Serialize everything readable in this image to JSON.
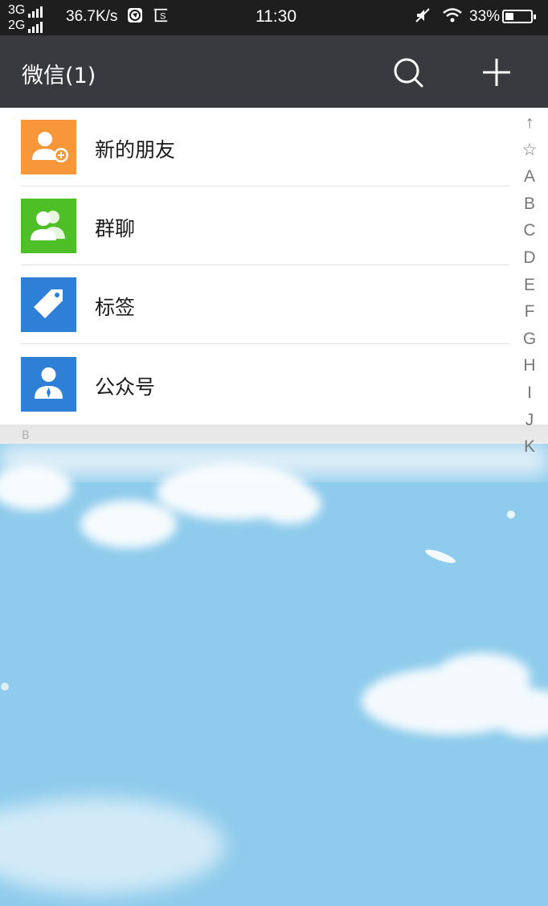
{
  "status_bar": {
    "net_type_1": "3G",
    "net_type_2": "2G",
    "speed": "36.7K/s",
    "time": "11:30",
    "battery_percent": "33%",
    "battery_level": 0.33
  },
  "header": {
    "title": "微信(1)",
    "icons": [
      "search-icon",
      "add-icon"
    ]
  },
  "contacts_menu": [
    {
      "label": "新的朋友",
      "icon": "add-friend-icon",
      "color": "#f7973a"
    },
    {
      "label": "群聊",
      "icon": "group-chat-icon",
      "color": "#4fbf28"
    },
    {
      "label": "标签",
      "icon": "tag-icon",
      "color": "#2e7fd6"
    },
    {
      "label": "公众号",
      "icon": "official-account-icon",
      "color": "#2e7fd6"
    }
  ],
  "section_header": "B",
  "index_bar": [
    "↑",
    "☆",
    "A",
    "B",
    "C",
    "D",
    "E",
    "F",
    "G",
    "H",
    "I",
    "J",
    "K"
  ]
}
